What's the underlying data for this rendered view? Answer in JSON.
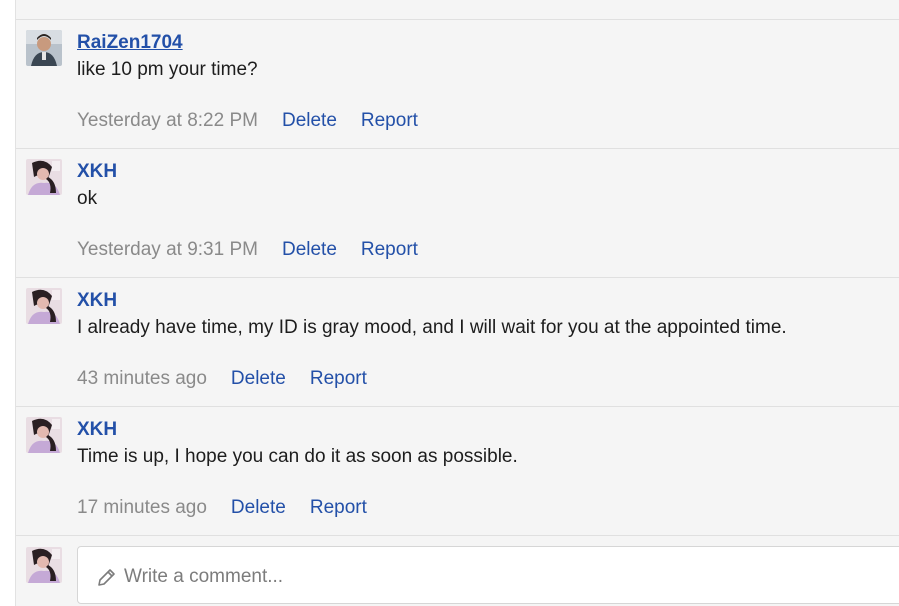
{
  "comments": [
    {
      "author": "RaiZen1704",
      "text": "like 10 pm your time?",
      "time": "Yesterday at 8:22 PM",
      "delete_label": "Delete",
      "report_label": "Report"
    },
    {
      "author": "XKH",
      "text": "ok",
      "time": "Yesterday at 9:31 PM",
      "delete_label": "Delete",
      "report_label": "Report"
    },
    {
      "author": "XKH",
      "text": "I already have time, my ID is gray mood, and I will wait for you at the appointed time.",
      "time": "43 minutes ago",
      "delete_label": "Delete",
      "report_label": "Report"
    },
    {
      "author": "XKH",
      "text": "Time is up, I hope you can do it as soon as possible.",
      "time": "17 minutes ago",
      "delete_label": "Delete",
      "report_label": "Report"
    }
  ],
  "composer": {
    "placeholder": "Write a comment..."
  },
  "colors": {
    "link": "#2350a8",
    "muted": "#8a8a8a",
    "panel": "#f5f5f5"
  },
  "icons": {
    "composer": "pencil-icon"
  }
}
